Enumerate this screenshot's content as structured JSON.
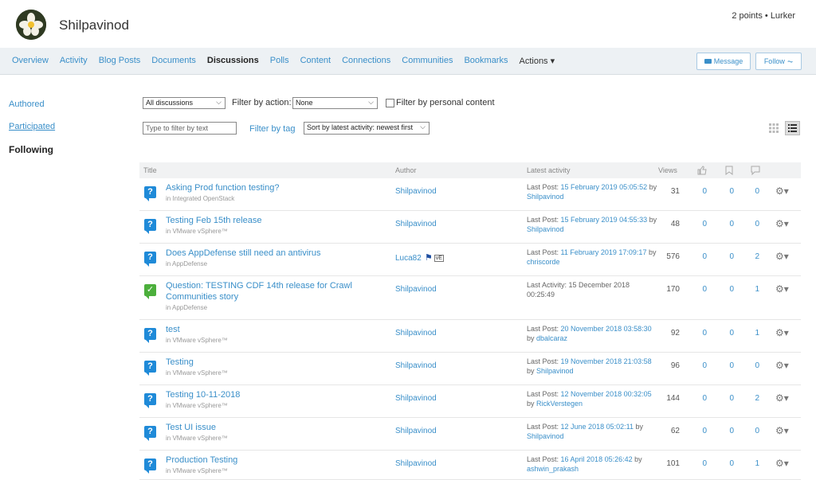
{
  "user": {
    "name": "Shilpavinod",
    "points": "2 points • Lurker"
  },
  "nav": {
    "items": [
      "Overview",
      "Activity",
      "Blog Posts",
      "Documents",
      "Discussions",
      "Polls",
      "Content",
      "Connections",
      "Communities",
      "Bookmarks",
      "Actions ▾"
    ],
    "message": "Message",
    "follow": "Follow"
  },
  "sidebar": {
    "authored": "Authored",
    "participated": "Participated",
    "following": "Following"
  },
  "filters": {
    "discussions": "All discussions",
    "action_label": "Filter by action:",
    "action_value": "None",
    "personal": "Filter by personal content",
    "text_placeholder": "Type to filter by text",
    "tag": "Filter by tag",
    "sort": "Sort by latest activity: newest first"
  },
  "table": {
    "headers": {
      "title": "Title",
      "author": "Author",
      "activity": "Latest activity",
      "views": "Views"
    },
    "rows": [
      {
        "title": "Asking Prod function testing?",
        "place": "in Integrated OpenStack",
        "author": "Shilpavinod",
        "act1": "Last Post: ",
        "date": "15 February 2019 05:05:52",
        "by": " by ",
        "who": "Shilpavinod",
        "views": "31",
        "c1": "0",
        "c2": "0",
        "c3": "0",
        "done": false
      },
      {
        "title": "Testing Feb 15th release",
        "place": "in VMware vSphere™",
        "author": "Shilpavinod",
        "act1": "Last Post: ",
        "date": "15 February 2019 04:55:33",
        "by": " by ",
        "who": "Shilpavinod",
        "views": "48",
        "c1": "0",
        "c2": "0",
        "c3": "0",
        "done": false
      },
      {
        "title": "Does AppDefense still need an antivirus",
        "place": "in AppDefense",
        "author": "Luca82",
        "badge": "vE",
        "act1": "Last Post: ",
        "date": "11 February 2019 17:09:17",
        "by": " by ",
        "who": "chriscorde",
        "views": "576",
        "c1": "0",
        "c2": "0",
        "c3": "2",
        "done": false
      },
      {
        "title": "Question: TESTING CDF 14th release for Crawl Communities story",
        "place": "in AppDefense",
        "author": "Shilpavinod",
        "act1": "Last Activity: 15 December 2018 00:25:49",
        "date": "",
        "by": "",
        "who": "",
        "views": "170",
        "c1": "0",
        "c2": "0",
        "c3": "1",
        "done": true
      },
      {
        "title": "test",
        "place": "in VMware vSphere™",
        "author": "Shilpavinod",
        "act1": "Last Post: ",
        "date": "20 November 2018 03:58:30",
        "by": " by ",
        "who": "dbalcaraz",
        "views": "92",
        "c1": "0",
        "c2": "0",
        "c3": "1",
        "done": false
      },
      {
        "title": "Testing",
        "place": "in VMware vSphere™",
        "author": "Shilpavinod",
        "act1": "Last Post: ",
        "date": "19 November 2018 21:03:58",
        "by": " by ",
        "who": "Shilpavinod",
        "views": "96",
        "c1": "0",
        "c2": "0",
        "c3": "0",
        "done": false
      },
      {
        "title": "Testing 10-11-2018",
        "place": "in VMware vSphere™",
        "author": "Shilpavinod",
        "act1": "Last Post: ",
        "date": "12 November 2018 00:32:05",
        "by": " by ",
        "who": "RickVerstegen",
        "views": "144",
        "c1": "0",
        "c2": "0",
        "c3": "2",
        "done": false
      },
      {
        "title": "Test UI issue",
        "place": "in VMware vSphere™",
        "author": "Shilpavinod",
        "act1": "Last Post: ",
        "date": "12 June 2018 05:02:11",
        "by": " by ",
        "who": "Shilpavinod",
        "views": "62",
        "c1": "0",
        "c2": "0",
        "c3": "0",
        "done": false
      },
      {
        "title": "Production Testing",
        "place": "in VMware vSphere™",
        "author": "Shilpavinod",
        "act1": "Last Post: ",
        "date": "16 April 2018 05:26:42",
        "by": " by ",
        "who": "ashwin_prakash",
        "views": "101",
        "c1": "0",
        "c2": "0",
        "c3": "1",
        "done": false
      }
    ]
  },
  "icons": [
    "like-icon",
    "bookmark-icon",
    "comment-icon",
    "gear-icon",
    "question-icon",
    "answered-icon",
    "envelope-icon",
    "follow-icon",
    "grid-view-icon",
    "list-view-icon"
  ],
  "colors": {
    "link": "#3a8fc9",
    "question": "#1f8ad8",
    "answered": "#4caf3c",
    "nav_bg": "#edf1f4"
  }
}
